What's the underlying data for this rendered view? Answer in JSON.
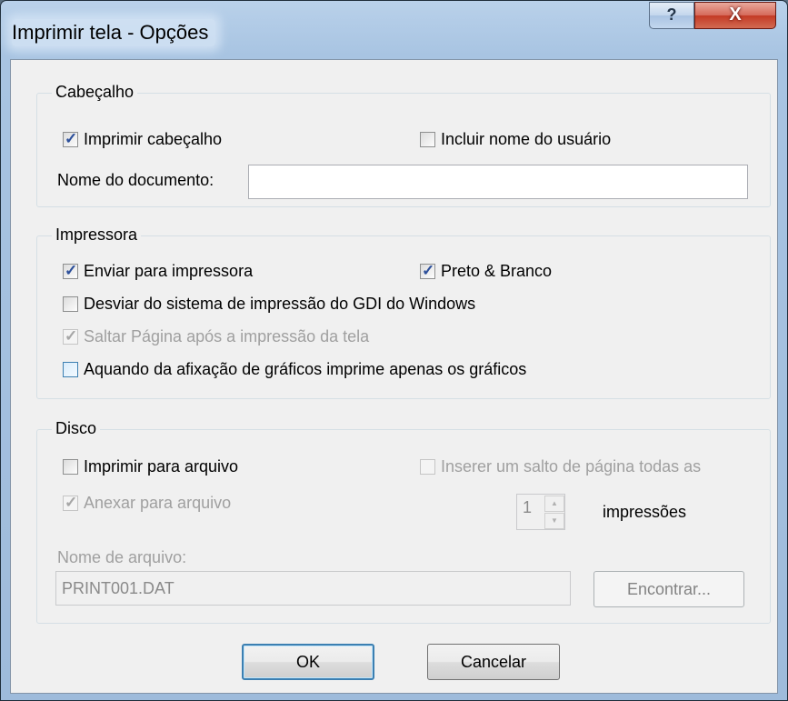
{
  "window": {
    "title": "Imprimir tela - Opções",
    "help_label": "?",
    "close_label": "X"
  },
  "header_group": {
    "title": "Cabeçalho",
    "print_header": {
      "label": "Imprimir cabeçalho",
      "checked": true
    },
    "include_user": {
      "label": "Incluir nome do usuário",
      "checked": false
    },
    "doc_name_label": "Nome do documento:",
    "doc_name_value": ""
  },
  "printer_group": {
    "title": "Impressora",
    "send_to_printer": {
      "label": "Enviar para impressora",
      "checked": true
    },
    "black_white": {
      "label": "Preto & Branco",
      "checked": true
    },
    "bypass_gdi": {
      "label": "Desviar do sistema de impressão do GDI do Windows",
      "checked": false
    },
    "page_break": {
      "label": "Saltar Página após a impressão da tela",
      "checked": true,
      "disabled": true
    },
    "graphics_only": {
      "label": "Aquando da afixação de gráficos imprime apenas os gráficos",
      "checked": false
    }
  },
  "disk_group": {
    "title": "Disco",
    "print_to_file": {
      "label": "Imprimir para arquivo",
      "checked": false
    },
    "append_to_file": {
      "label": "Anexar para arquivo",
      "checked": true,
      "disabled": true
    },
    "insert_break": {
      "label": "Inserer um salto de página todas as",
      "checked": false,
      "disabled": true
    },
    "spinner_value": "1",
    "impressions_label": "impressões",
    "file_name_label": "Nome de arquivo:",
    "file_name_value": "PRINT001.DAT",
    "find_button": "Encontrar..."
  },
  "buttons": {
    "ok": "OK",
    "cancel": "Cancelar"
  }
}
